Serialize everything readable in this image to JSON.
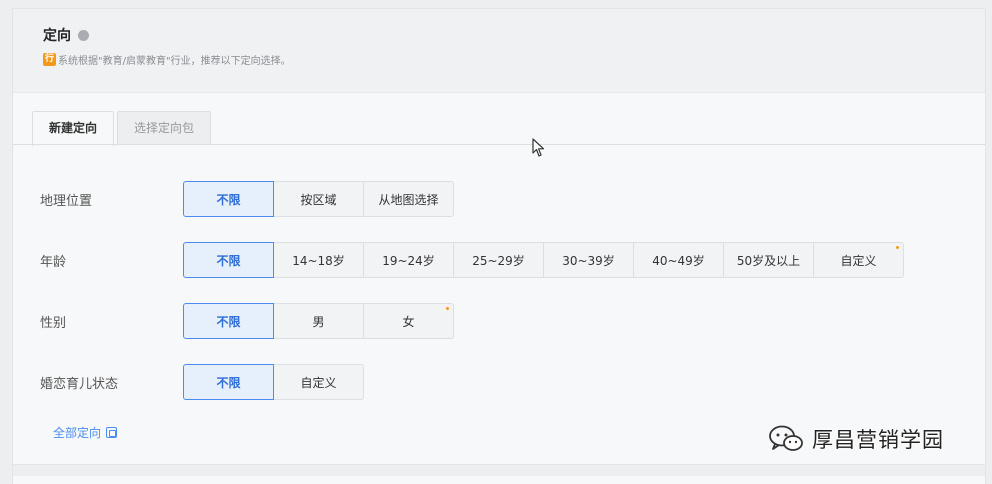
{
  "header": {
    "title": "定向",
    "tip_icon": "行",
    "tip": "系统根据\"教育/启蒙教育\"行业，推荐以下定向选择。"
  },
  "tabs": [
    {
      "label": "新建定向",
      "active": true
    },
    {
      "label": "选择定向包",
      "active": false
    }
  ],
  "rows": [
    {
      "label": "地理位置",
      "options": [
        "不限",
        "按区域",
        "从地图选择"
      ]
    },
    {
      "label": "年龄",
      "options": [
        "不限",
        "14~18岁",
        "19~24岁",
        "25~29岁",
        "30~39岁",
        "40~49岁",
        "50岁及以上",
        "自定义"
      ]
    },
    {
      "label": "性别",
      "options": [
        "不限",
        "男",
        "女"
      ]
    },
    {
      "label": "婚恋育儿状态",
      "options": [
        "不限",
        "自定义"
      ]
    }
  ],
  "all_link": "全部定向",
  "watermark": "厚昌营销学园",
  "colors": {
    "accent": "#4a8cf0",
    "tip": "#f39a1d"
  }
}
